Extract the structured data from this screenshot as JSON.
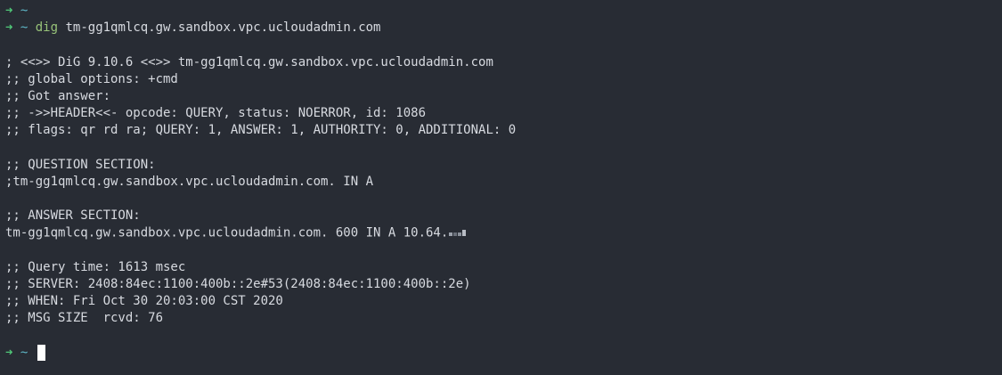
{
  "prompt": {
    "arrow": "➜",
    "cwd": "~"
  },
  "command": {
    "name": "dig",
    "args": "tm-gg1qmlcq.gw.sandbox.vpc.ucloudadmin.com"
  },
  "output": {
    "header_line": "; <<>> DiG 9.10.6 <<>> tm-gg1qmlcq.gw.sandbox.vpc.ucloudadmin.com",
    "global_options": ";; global options: +cmd",
    "got_answer": ";; Got answer:",
    "header_info": ";; ->>HEADER<<- opcode: QUERY, status: NOERROR, id: 1086",
    "flags": ";; flags: qr rd ra; QUERY: 1, ANSWER: 1, AUTHORITY: 0, ADDITIONAL: 0",
    "question_title": ";; QUESTION SECTION:",
    "question_record": ";tm-gg1qmlcq.gw.sandbox.vpc.ucloudadmin.com. IN A",
    "answer_title": ";; ANSWER SECTION:",
    "answer_record": "tm-gg1qmlcq.gw.sandbox.vpc.ucloudadmin.com. 600 IN A 10.64.",
    "query_time": ";; Query time: 1613 msec",
    "server": ";; SERVER: 2408:84ec:1100:400b::2e#53(2408:84ec:1100:400b::2e)",
    "when": ";; WHEN: Fri Oct 30 20:03:00 CST 2020",
    "msg_size": ";; MSG SIZE  rcvd: 76"
  },
  "colors": {
    "background": "#282c34",
    "prompt_arrow": "#50c878",
    "prompt_cwd": "#5fb8c8",
    "command": "#98c379",
    "text": "#d7dae0",
    "cursor": "#ffffff"
  }
}
